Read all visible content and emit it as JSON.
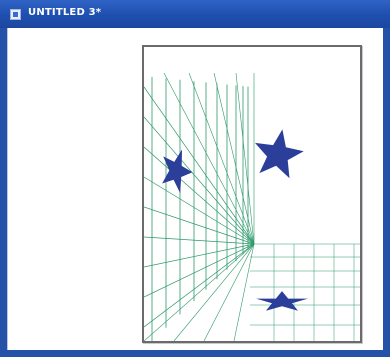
{
  "window": {
    "title": "UNTITLED 3*"
  },
  "colors": {
    "titlebar": "#2452a8",
    "grid_line": "#2e9a6a",
    "star_fill": "#2b3f9a",
    "frame_border": "#6b6b6b"
  },
  "icons": {
    "window": "document-icon"
  }
}
